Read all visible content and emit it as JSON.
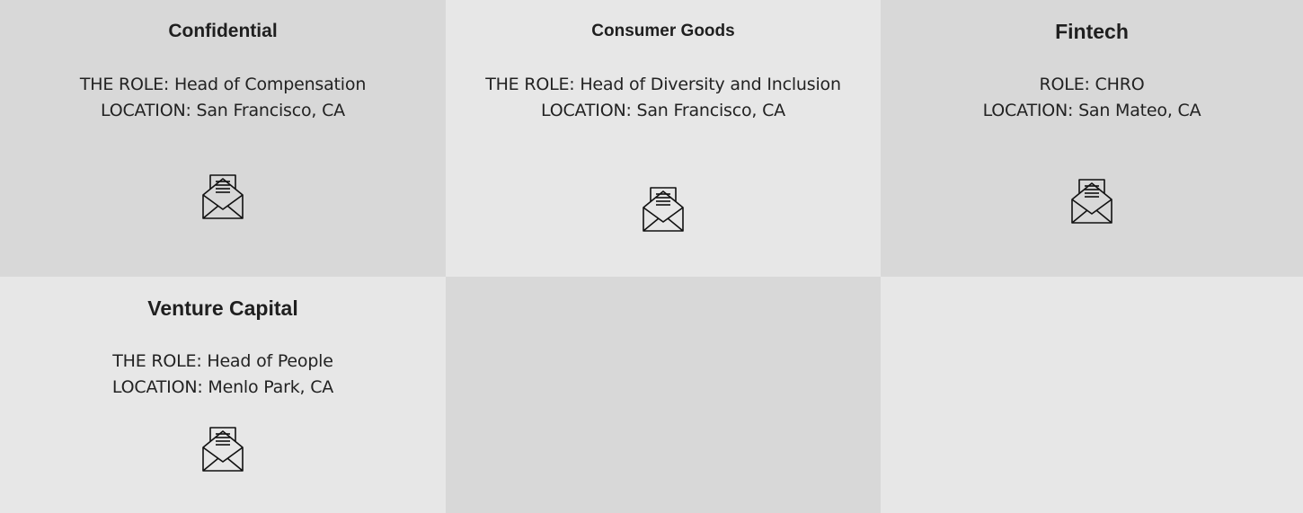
{
  "cards": [
    {
      "company": "Confidential",
      "lines": [
        "THE ROLE: Head of Compensation",
        "LOCATION: San Francisco, CA"
      ],
      "icon": "envelope-letter-icon"
    },
    {
      "company": "Consumer Goods",
      "lines": [
        "THE ROLE: Head of Diversity and Inclusion",
        "LOCATION: San Francisco, CA"
      ],
      "icon": "envelope-letter-icon"
    },
    {
      "company": "Fintech",
      "lines": [
        "ROLE: CHRO",
        "LOCATION: San Mateo, CA"
      ],
      "icon": "envelope-letter-icon"
    },
    {
      "company": "Venture Capital",
      "lines": [
        "THE ROLE: Head of People",
        "LOCATION: Menlo Park, CA"
      ],
      "icon": "envelope-letter-icon"
    }
  ],
  "colors": {
    "tile_dark": "#d8d8d8",
    "tile_light": "#e7e7e7",
    "text": "#1f1f1f"
  }
}
